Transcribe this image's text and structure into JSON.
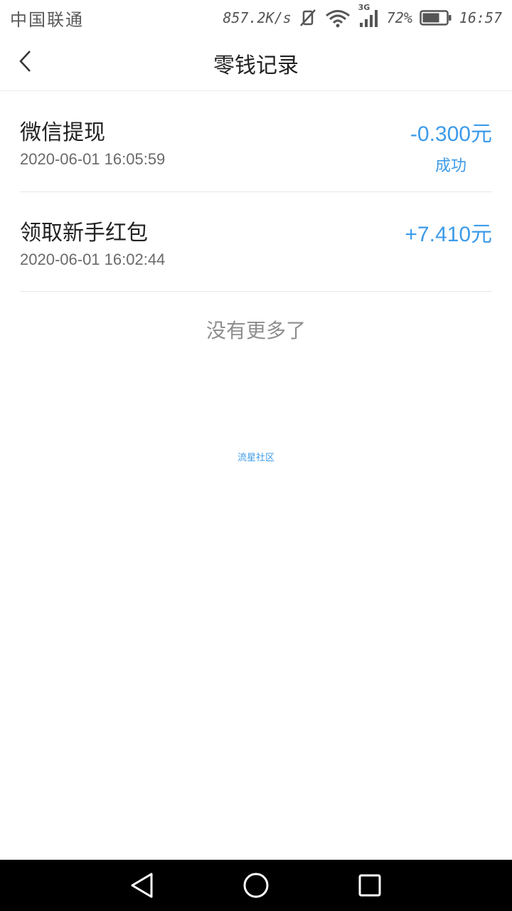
{
  "status_bar": {
    "carrier": "中国联通",
    "net_speed": "857.2K/s",
    "network_type": "3G",
    "battery": "72%",
    "time": "16:57"
  },
  "header": {
    "title": "零钱记录"
  },
  "records": [
    {
      "title": "微信提现",
      "time": "2020-06-01 16:05:59",
      "amount": "-0.300元",
      "status": "成功"
    },
    {
      "title": "领取新手红包",
      "time": "2020-06-01 16:02:44",
      "amount": "+7.410元"
    }
  ],
  "footer": {
    "no_more": "没有更多了",
    "watermark": "流星社区"
  },
  "colors": {
    "accent": "#3d9be9",
    "text_primary": "#222222",
    "text_secondary": "#6a6a6a",
    "nav_bar": "#000000"
  },
  "battery_level": 0.72
}
